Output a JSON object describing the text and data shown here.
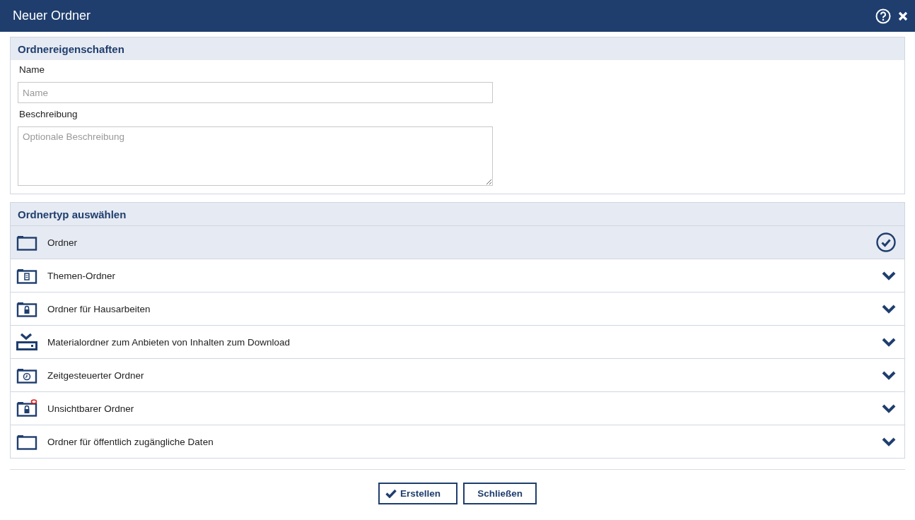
{
  "window": {
    "title": "Neuer Ordner"
  },
  "properties": {
    "heading": "Ordnereigenschaften",
    "name_label": "Name",
    "name_field": {
      "placeholder": "Name"
    },
    "description_label": "Beschreibung",
    "description_field": {
      "placeholder": "Optionale Beschreibung"
    }
  },
  "folder_types": {
    "heading": "Ordnertyp auswählen",
    "items": [
      {
        "label": "Ordner",
        "kind": "plain",
        "selected": true
      },
      {
        "label": "Themen-Ordner",
        "kind": "topic",
        "selected": false
      },
      {
        "label": "Ordner für Hausarbeiten",
        "kind": "locked",
        "selected": false
      },
      {
        "label": "Materialordner zum Anbieten von Inhalten zum Download",
        "kind": "download",
        "selected": false
      },
      {
        "label": "Zeitgesteuerter Ordner",
        "kind": "timed",
        "selected": false
      },
      {
        "label": "Unsichtbarer Ordner",
        "kind": "invisible",
        "selected": false
      },
      {
        "label": "Ordner für öffentlich zugängliche Daten",
        "kind": "plain",
        "selected": false
      }
    ]
  },
  "buttons": [
    {
      "label": "Erstellen",
      "kind": "primary"
    },
    {
      "label": "Schließen",
      "kind": "secondary"
    }
  ]
}
